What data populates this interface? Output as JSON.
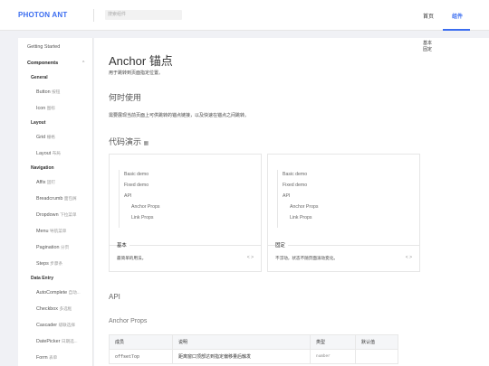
{
  "header": {
    "logo": "PHOTON ANT",
    "search_placeholder": "搜索组件",
    "nav": {
      "home": "首页",
      "components": "组件"
    }
  },
  "sidebar": {
    "getting_started": "Getting Started",
    "components": "Components",
    "caret": "^",
    "groups": [
      {
        "label": "General",
        "items": [
          {
            "en": "Button",
            "cn": "按钮"
          },
          {
            "en": "Icon",
            "cn": "图标"
          }
        ]
      },
      {
        "label": "Layout",
        "items": [
          {
            "en": "Grid",
            "cn": "栅格"
          },
          {
            "en": "Layout",
            "cn": "布局"
          }
        ]
      },
      {
        "label": "Navigation",
        "items": [
          {
            "en": "Affix",
            "cn": "固钉"
          },
          {
            "en": "Breadcrumb",
            "cn": "面包屑"
          },
          {
            "en": "Dropdown",
            "cn": "下拉菜单"
          },
          {
            "en": "Menu",
            "cn": "导航菜单"
          },
          {
            "en": "Pagination",
            "cn": "分页"
          },
          {
            "en": "Steps",
            "cn": "步骤条"
          }
        ]
      },
      {
        "label": "Data Entry",
        "items": [
          {
            "en": "AutoComplete",
            "cn": "自动..."
          },
          {
            "en": "Checkbox",
            "cn": "多选框"
          },
          {
            "en": "Cascader",
            "cn": "级联选择"
          },
          {
            "en": "DatePicker",
            "cn": "日期选..."
          },
          {
            "en": "Form",
            "cn": "表单"
          }
        ]
      }
    ]
  },
  "toc": {
    "basic": "基本",
    "fixed": "固定"
  },
  "page": {
    "title": "Anchor 锚点",
    "subtitle": "用于跳转到页面指定位置。",
    "when_heading": "何时使用",
    "when_text": "需要展现当前页面上可供跳转的锚点链接，以及快速在锚点之间跳转。",
    "demo_heading": "代码演示",
    "demo_icon": "▦",
    "api_heading": "API",
    "props_heading": "Anchor Props"
  },
  "demos": [
    {
      "links": [
        "Basic demo",
        "Fixed demo",
        "API",
        "Anchor Props",
        "Link Props"
      ],
      "title": "基本",
      "desc": "最简单的用法。",
      "code_icon": "< >"
    },
    {
      "links": [
        "Basic demo",
        "Fixed demo",
        "API",
        "Anchor Props",
        "Link Props"
      ],
      "title": "固定",
      "desc": "不浮动，状态不随页面滚动变化。",
      "code_icon": "< >"
    }
  ],
  "table": {
    "headers": [
      "成员",
      "说明",
      "类型",
      "默认值"
    ],
    "rows": [
      [
        "offsetTop",
        "距离窗口顶部达到指定偏移量后触发",
        "number",
        ""
      ]
    ]
  }
}
